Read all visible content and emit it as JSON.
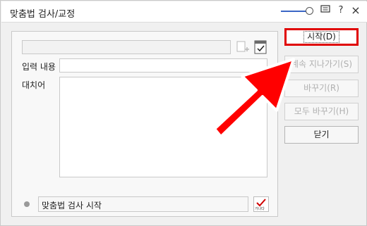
{
  "window": {
    "title": "맞춤법 검사/교정",
    "toolbar_icons": [
      "zoom-slider",
      "comment-icon",
      "help-icon",
      "close-icon"
    ],
    "help_label": "?",
    "close_label": "×"
  },
  "fields": {
    "input_label": "입력 내용",
    "replace_label": "대치어",
    "status_text": "맞춤법 검사 시작"
  },
  "buttons": {
    "start": "시작(D)",
    "skip": "계속 지나가기(S)",
    "replace": "바꾸기(R)",
    "replace_all": "모두 바꾸기(H)",
    "close": "닫기"
  },
  "icons": {
    "add_dictionary": "add-dictionary-icon",
    "dictionary": "dictionary-icon",
    "check_option": "check-icon",
    "check_option_caption": "가나다"
  },
  "colors": {
    "highlight_border": "#e00000",
    "arrow": "#ff0000",
    "slider": "#3a66c5"
  }
}
